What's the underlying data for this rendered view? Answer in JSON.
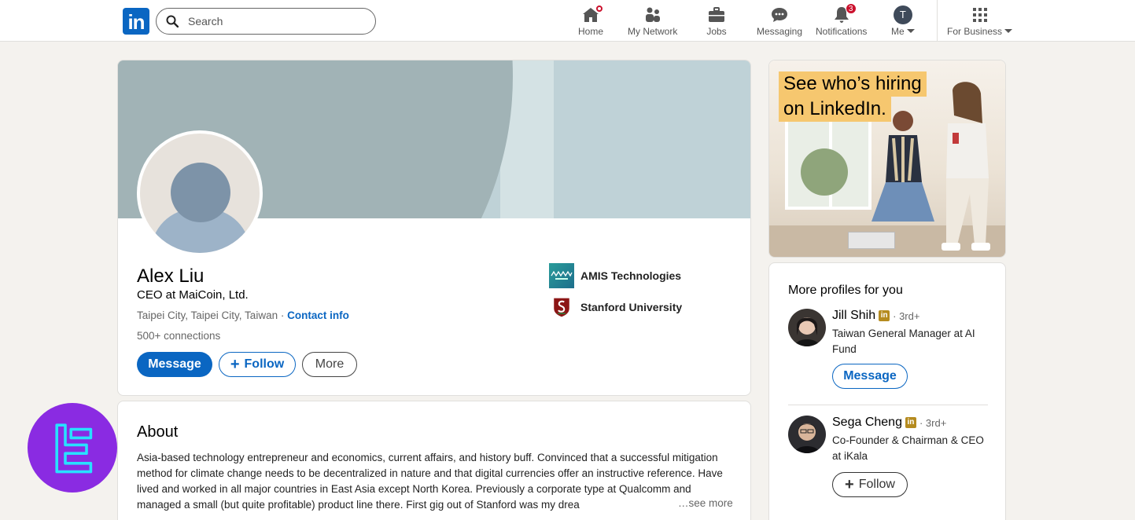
{
  "nav": {
    "search_placeholder": "Search",
    "logo_text": "in",
    "items": [
      {
        "label": "Home",
        "icon": "home-icon"
      },
      {
        "label": "My Network",
        "icon": "network-icon"
      },
      {
        "label": "Jobs",
        "icon": "briefcase-icon"
      },
      {
        "label": "Messaging",
        "icon": "messaging-icon"
      },
      {
        "label": "Notifications",
        "icon": "bell-icon",
        "badge": "3"
      },
      {
        "label": "Me",
        "icon": "avatar",
        "avatar_initial": "T"
      },
      {
        "label": "For Business",
        "icon": "grid-icon"
      }
    ]
  },
  "profile": {
    "name": "Alex Liu",
    "headline": "CEO at MaiCoin, Ltd.",
    "location": "Taipei City, Taipei City, Taiwan",
    "separator": "·",
    "contact_info": "Contact info",
    "connections": "500+ connections",
    "buttons": {
      "message": "Message",
      "follow": "Follow",
      "more": "More"
    },
    "orgs": [
      {
        "name": "AMIS Technologies"
      },
      {
        "name": "Stanford University"
      }
    ]
  },
  "about": {
    "title": "About",
    "text": "Asia-based technology entrepreneur and economics, current affairs, and history buff. Convinced that a successful mitigation method for climate change needs to be decentralized in nature and that digital currencies offer an instructive reference. Have lived and worked in all major countries in East Asia except North Korea. Previously a corporate type at Qualcomm and managed a small (but quite profitable) product line there. First gig out of Stanford was my drea",
    "see_more": "…see more"
  },
  "ad": {
    "line1": "See who’s hiring",
    "line2": "on LinkedIn."
  },
  "more_profiles": {
    "title": "More profiles for you",
    "people": [
      {
        "name": "Jill Shih",
        "degree": "· 3rd+",
        "headline": "Taiwan General Manager at AI Fund",
        "button": "Message"
      },
      {
        "name": "Sega Cheng",
        "degree": "· 3rd+",
        "headline": "Co-Founder & Chairman & CEO at iKala",
        "button": "Follow"
      }
    ]
  },
  "colors": {
    "brand": "#0a66c2",
    "badge": "#cb112d",
    "watermark": "#8a2be2"
  }
}
